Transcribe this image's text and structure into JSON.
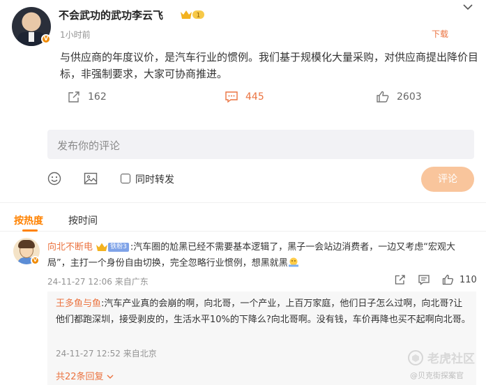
{
  "post": {
    "author": "不会武功的武功李云飞",
    "level_badge": "1",
    "time": "1小时前",
    "download": "下载",
    "text": "与供应商的年度议价，是汽车行业的惯例。我们基于规模化大量采购，对供应商提出降价目标，非强制要求，大家可协商推进。",
    "reposts": "162",
    "comments": "445",
    "likes": "2603"
  },
  "compose": {
    "placeholder": "发布你的评论",
    "repost_label": "同时转发",
    "submit": "评论"
  },
  "sort": {
    "hot": "按热度",
    "time": "按时间"
  },
  "comment": {
    "user": "向北不断电",
    "fans_badge": "铁粉3",
    "text": ":汽车圈的尬黑已经不需要基本逻辑了，黑子一会站边消费者，一边又考虑“宏观大局”，主打一个身份自由切换，完全忽略行业惯例，想黑就黑",
    "time": "24-11-27 12:06",
    "location": "来自广东",
    "likes": "110"
  },
  "reply": {
    "user": "王多鱼与鱼",
    "text": ":汽车产业真的会崩的啊，向北哥，一个产业，上百万家庭，他们日子怎么过啊，向北哥?让他们都跑深圳，接受剥皮的，生活水平10%的下降么?向北哥啊。没有钱，车价再降也买不起啊向北哥。",
    "time": "24-11-27 12:52",
    "location": "来自北京",
    "more": "共22条回复"
  },
  "watermark": {
    "brand": "老虎社区",
    "handle": "@贝克街探案官"
  },
  "colors": {
    "accent": "#eb7340",
    "hot": "#ff8200",
    "submit_disabled": "#f9c59c"
  }
}
